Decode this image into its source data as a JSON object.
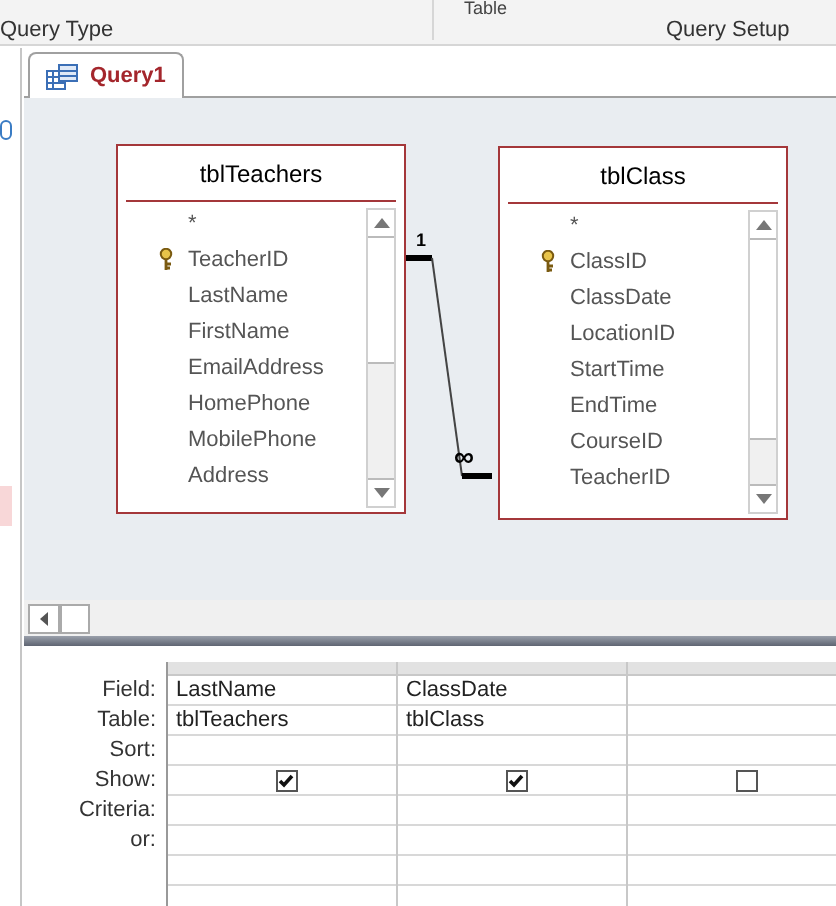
{
  "ribbon": {
    "cut_label": "Table",
    "group_labels": [
      "Query Type",
      "Query Setup"
    ]
  },
  "document_tab": {
    "label": "Query1",
    "selected": true
  },
  "tables": [
    {
      "name": "tblTeachers",
      "fields": [
        {
          "name": "*",
          "primary_key": false
        },
        {
          "name": "TeacherID",
          "primary_key": true
        },
        {
          "name": "LastName",
          "primary_key": false
        },
        {
          "name": "FirstName",
          "primary_key": false
        },
        {
          "name": "EmailAddress",
          "primary_key": false
        },
        {
          "name": "HomePhone",
          "primary_key": false
        },
        {
          "name": "MobilePhone",
          "primary_key": false
        },
        {
          "name": "Address",
          "primary_key": false
        }
      ]
    },
    {
      "name": "tblClass",
      "fields": [
        {
          "name": "*",
          "primary_key": false
        },
        {
          "name": "ClassID",
          "primary_key": true
        },
        {
          "name": "ClassDate",
          "primary_key": false
        },
        {
          "name": "LocationID",
          "primary_key": false
        },
        {
          "name": "StartTime",
          "primary_key": false
        },
        {
          "name": "EndTime",
          "primary_key": false
        },
        {
          "name": "CourseID",
          "primary_key": false
        },
        {
          "name": "TeacherID",
          "primary_key": false
        }
      ]
    }
  ],
  "relationship": {
    "one_label": "1",
    "many_label": "∞"
  },
  "grid": {
    "row_labels": [
      "Field:",
      "Table:",
      "Sort:",
      "Show:",
      "Criteria:",
      "or:"
    ],
    "columns": [
      {
        "field": "LastName",
        "table": "tblTeachers",
        "show": true
      },
      {
        "field": "ClassDate",
        "table": "tblClass",
        "show": true
      },
      {
        "show": false
      }
    ]
  }
}
